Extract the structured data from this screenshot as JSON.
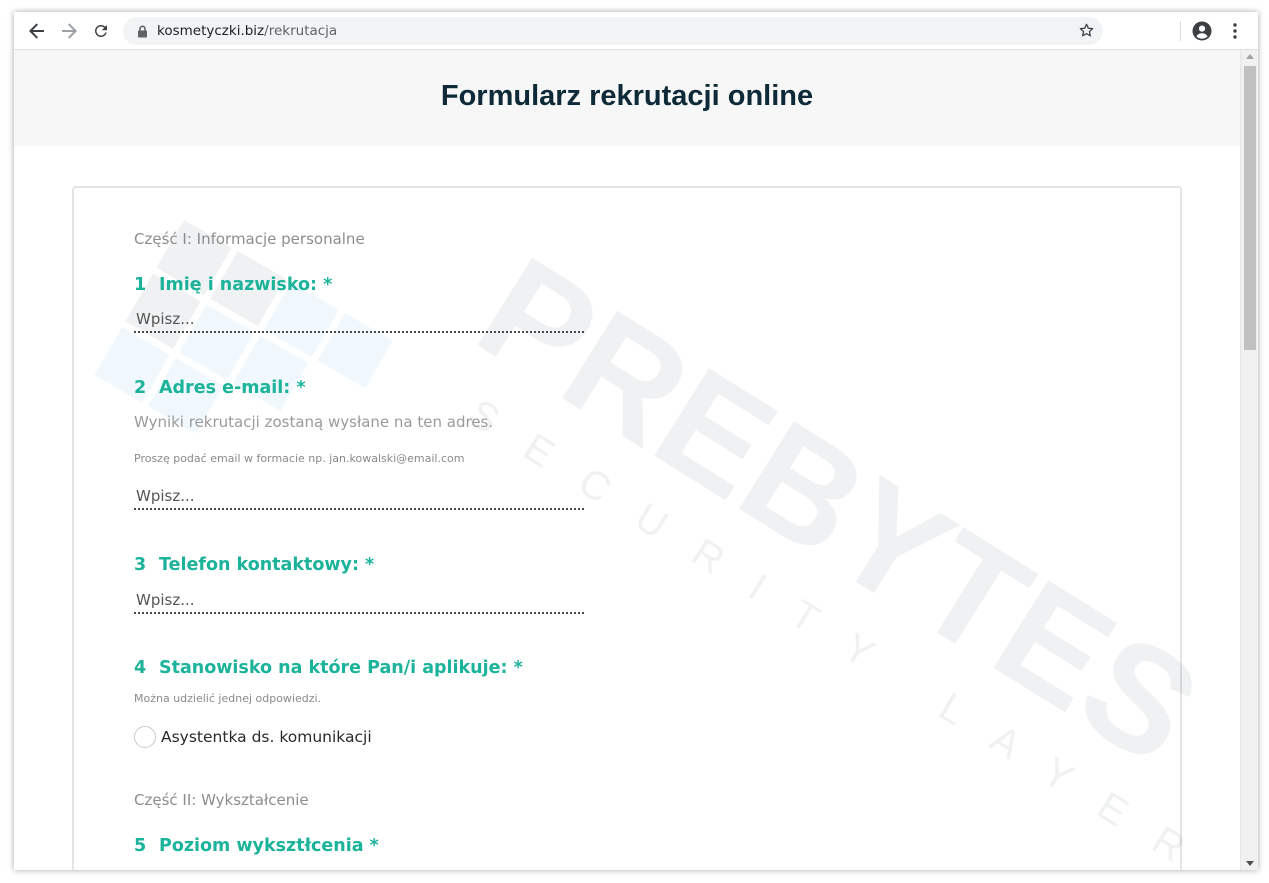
{
  "browser": {
    "url_domain": "kosmetyczki.biz",
    "url_path": "/rekrutacja"
  },
  "page": {
    "title": "Formularz rekrutacji online"
  },
  "form": {
    "section1_label": "Część I: Informacje personalne",
    "q1": {
      "number": "1",
      "label": "Imię i nazwisko: *",
      "placeholder": "Wpisz..."
    },
    "q2": {
      "number": "2",
      "label": "Adres e-mail: *",
      "description": "Wyniki rekrutacji zostaną wysłane na ten adres.",
      "hint": "Proszę podać email w formacie np. jan.kowalski@email.com",
      "placeholder": "Wpisz..."
    },
    "q3": {
      "number": "3",
      "label": "Telefon kontaktowy: *",
      "placeholder": "Wpisz..."
    },
    "q4": {
      "number": "4",
      "label": "Stanowisko na które Pan/i aplikuje: *",
      "hint": "Można udzielić jednej odpowiedzi.",
      "options": [
        "Asystentka ds. komunikacji"
      ]
    },
    "section2_label": "Część II: Wykształcenie",
    "q5": {
      "number": "5",
      "label": "Poziom wyksztłcenia *"
    }
  },
  "watermark": {
    "brand": "PREBYTES",
    "sub": "SECURITY LAYER"
  },
  "colors": {
    "accent": "#1cb39b",
    "title": "#0e2a38"
  }
}
